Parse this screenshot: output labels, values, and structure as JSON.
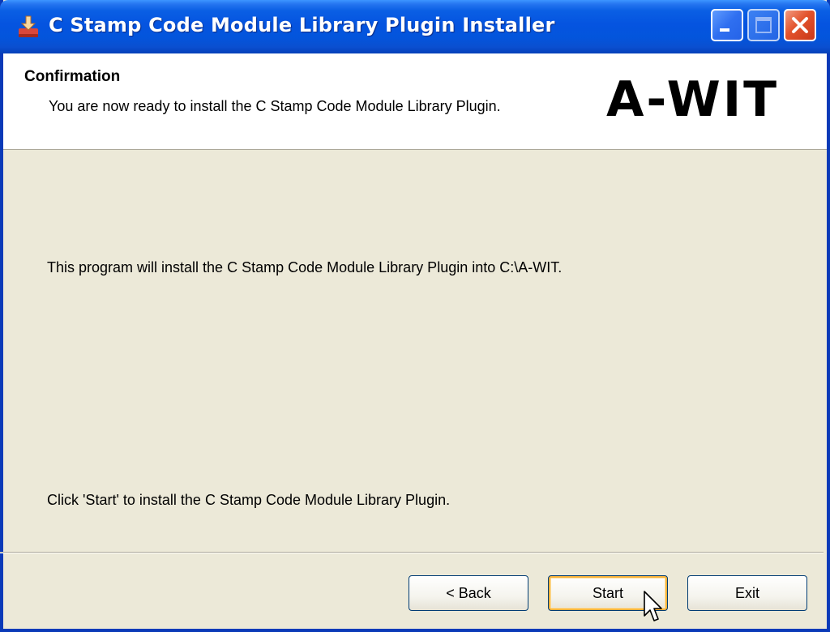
{
  "window": {
    "title": "C Stamp Code Module Library Plugin Installer",
    "icons": {
      "app": "installer-icon",
      "minimize": "minimize-icon",
      "maximize": "maximize-icon",
      "close": "close-icon"
    }
  },
  "header": {
    "title": "Confirmation",
    "description": "You are now ready to install the C Stamp Code Module Library Plugin.",
    "logo": "A-WIT"
  },
  "body": {
    "line1": "This program will install the C Stamp Code Module Library Plugin into C:\\A-WIT.",
    "line2": "Click 'Start' to install the C Stamp Code Module Library Plugin."
  },
  "buttons": {
    "back": "< Back",
    "start": "Start",
    "exit": "Exit"
  },
  "colors": {
    "titlebar": "#0554e0",
    "background": "#ece9d8",
    "header_bg": "#ffffff",
    "focus_ring": "#f8b33c",
    "close_button": "#e2522c"
  }
}
